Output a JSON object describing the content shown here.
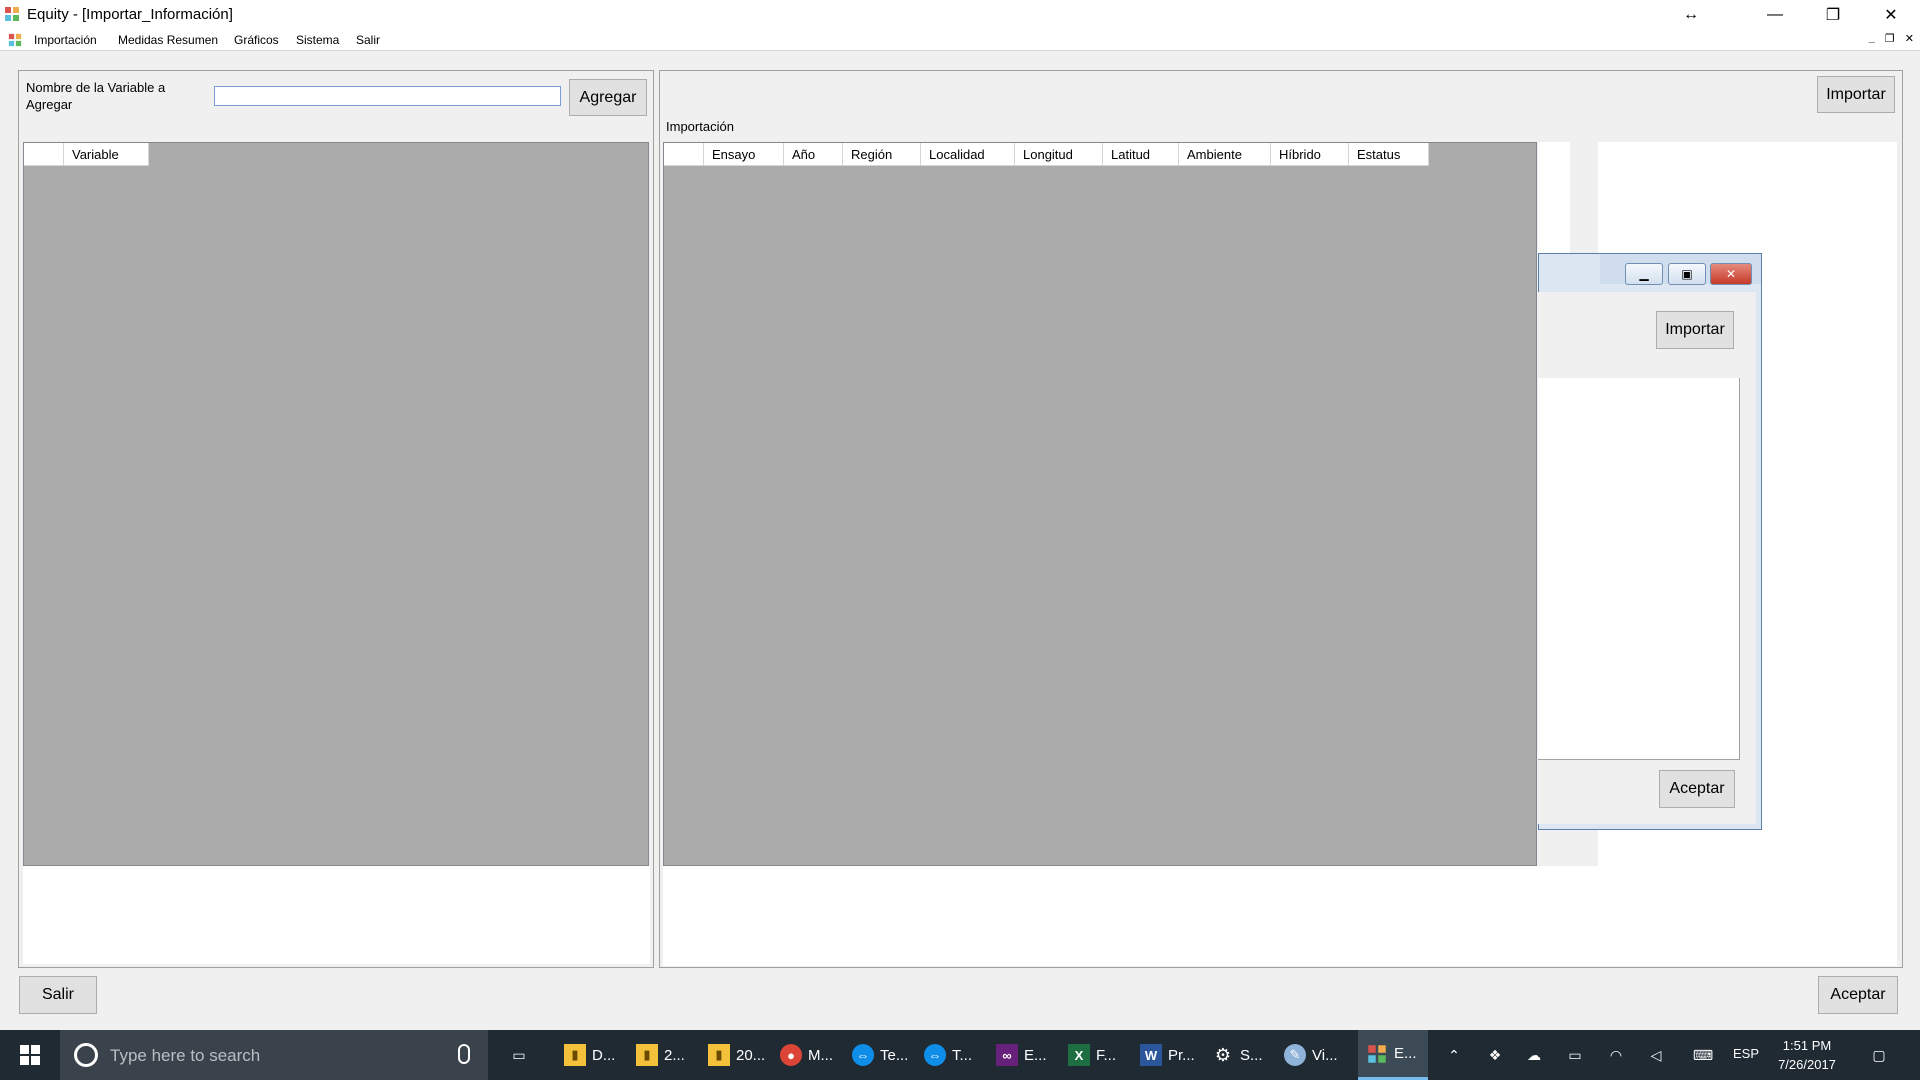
{
  "window": {
    "title": "Equity - [Importar_Información]",
    "resize_glyph": "↔",
    "minimize_glyph": "—",
    "restore_glyph": "❐",
    "close_glyph": "✕"
  },
  "menu": {
    "items": [
      "Importación",
      "Medidas Resumen",
      "Gráficos",
      "Sistema",
      "Salir"
    ],
    "mdi_min": "_",
    "mdi_restore": "❐",
    "mdi_close": "✕"
  },
  "left_panel": {
    "field_label": "Nombre de la Variable a Agregar",
    "input_value": "",
    "add_button": "Agregar",
    "grid_columns": [
      "Variable"
    ]
  },
  "right_panel": {
    "import_button": "Importar",
    "section_label": "Importación",
    "grid_columns": [
      "Ensayo",
      "Año",
      "Región",
      "Localidad",
      "Longitud",
      "Latitud",
      "Ambiente",
      "Híbrido",
      "Estatus"
    ]
  },
  "background_dialog": {
    "import_button": "Importar",
    "accept_button": "Aceptar"
  },
  "footer": {
    "exit_button": "Salir",
    "accept_button": "Aceptar"
  },
  "taskbar": {
    "search_placeholder": "Type here to search",
    "items": [
      {
        "label": "D...",
        "icon": "folder-icon"
      },
      {
        "label": "2...",
        "icon": "folder-icon"
      },
      {
        "label": "20...",
        "icon": "folder-icon"
      },
      {
        "label": "M...",
        "icon": "chrome-icon"
      },
      {
        "label": "Te...",
        "icon": "teamviewer-icon"
      },
      {
        "label": "T...",
        "icon": "teamviewer-icon"
      },
      {
        "label": "E...",
        "icon": "visual-studio-icon"
      },
      {
        "label": "F...",
        "icon": "excel-icon"
      },
      {
        "label": "Pr...",
        "icon": "word-icon"
      },
      {
        "label": "S...",
        "icon": "settings-icon"
      },
      {
        "label": "Vi...",
        "icon": "paint-icon"
      },
      {
        "label": "E...",
        "icon": "equity-app-icon"
      }
    ],
    "language": "ESP",
    "time": "1:51 PM",
    "date": "7/26/2017"
  },
  "colors": {
    "grid_bg": "#ababab",
    "taskbar_bg": "#1f2a33",
    "accent": "#76b9ed"
  }
}
